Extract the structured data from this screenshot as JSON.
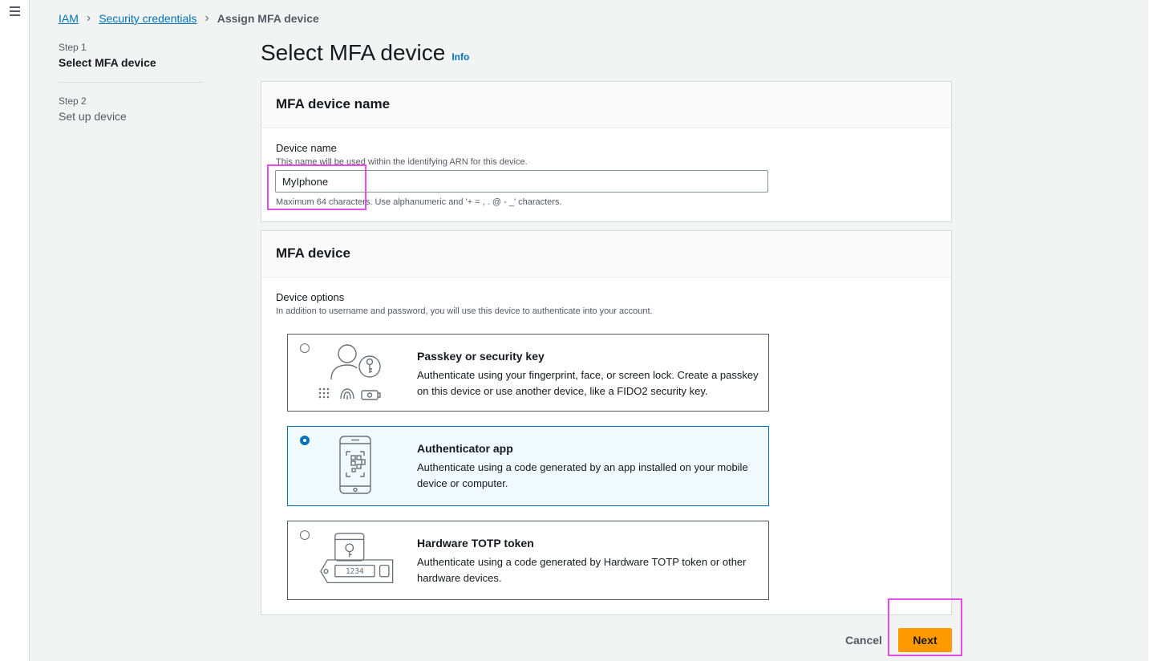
{
  "breadcrumb": [
    "IAM",
    "Security credentials",
    "Assign MFA device"
  ],
  "steps": [
    {
      "num": "Step 1",
      "title": "Select MFA device"
    },
    {
      "num": "Step 2",
      "title": "Set up device"
    }
  ],
  "page": {
    "title": "Select MFA device",
    "info": "Info"
  },
  "name_panel": {
    "header": "MFA device name",
    "label": "Device name",
    "description": "This name will be used within the identifying ARN for this device.",
    "value": "MyIphone",
    "constraint": "Maximum 64 characters. Use alphanumeric and '+ = , . @ - _' characters."
  },
  "device_panel": {
    "header": "MFA device",
    "label": "Device options",
    "description": "In addition to username and password, you will use this device to authenticate into your account.",
    "selected": "Authenticator app",
    "options": [
      {
        "title": "Passkey or security key",
        "description": "Authenticate using your fingerprint, face, or screen lock. Create a passkey on this device or use another device, like a FIDO2 security key.",
        "icon": "passkey-icon"
      },
      {
        "title": "Authenticator app",
        "description": "Authenticate using a code generated by an app installed on your mobile device or computer.",
        "icon": "authenticator-app-icon"
      },
      {
        "title": "Hardware TOTP token",
        "description": "Authenticate using a code generated by Hardware TOTP token or other hardware devices.",
        "icon": "hardware-token-icon",
        "token_display": "1234"
      }
    ]
  },
  "actions": {
    "cancel": "Cancel",
    "next": "Next"
  },
  "colors": {
    "primary_button": "#ff9900",
    "link": "#0073bb",
    "highlight": "#e84ce8"
  }
}
